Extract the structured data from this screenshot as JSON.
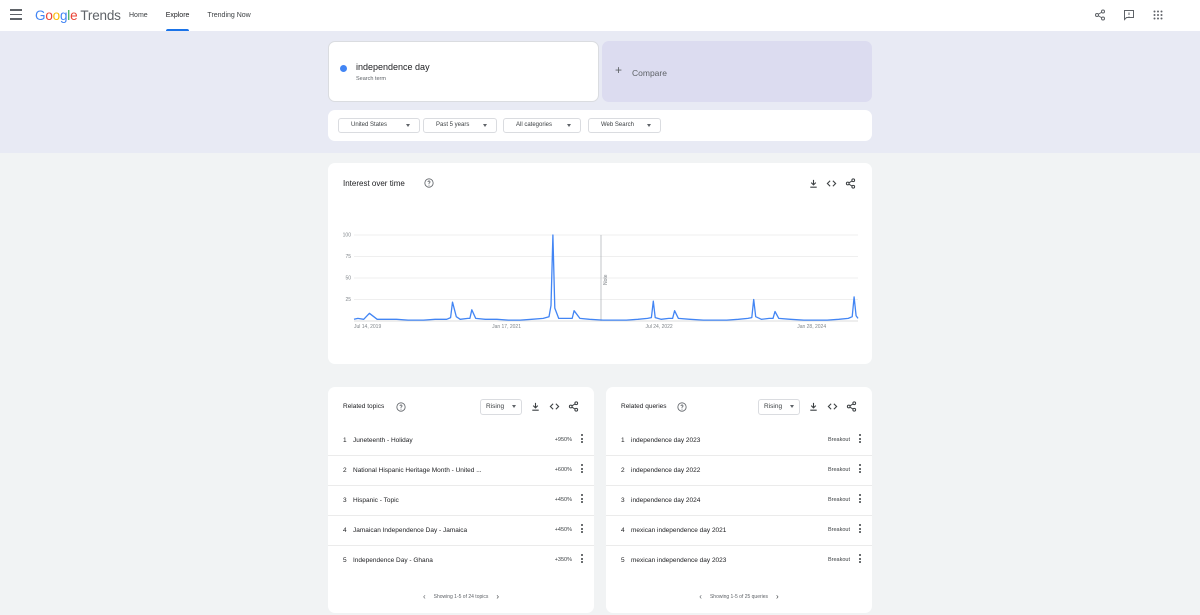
{
  "header": {
    "logo": "Google",
    "logo_suffix": "Trends",
    "nav": [
      "Home",
      "Explore",
      "Trending Now"
    ],
    "active_nav": "Explore"
  },
  "search": {
    "term": "independence day",
    "term_type": "Search term",
    "compare_label": "Compare",
    "term_color": "#4285f4"
  },
  "filters": {
    "region": "United States",
    "period": "Past 5 years",
    "category": "All categories",
    "property": "Web Search"
  },
  "interest": {
    "title": "Interest over time",
    "note_label": "Note"
  },
  "chart_data": {
    "type": "line",
    "title": "Interest over time",
    "ylim": [
      0,
      100
    ],
    "y_ticks": [
      "100",
      "75",
      "50",
      "25"
    ],
    "x_tick_labels": [
      "Jul 14, 2019",
      "Jan 17, 2021",
      "Jul 24, 2022",
      "Jan 28, 2024"
    ],
    "grid": true,
    "series": [
      {
        "color": "#4285f4",
        "x": [
          "2019-07-14",
          "2019-07-28",
          "2019-08-18",
          "2019-09-08",
          "2019-10-06",
          "2019-11-03",
          "2019-12-15",
          "2020-01-26",
          "2020-02-23",
          "2020-03-22",
          "2020-05-03",
          "2020-06-14",
          "2020-06-28",
          "2020-07-05",
          "2020-07-19",
          "2020-08-02",
          "2020-08-30",
          "2020-09-06",
          "2020-09-13",
          "2020-09-27",
          "2020-11-01",
          "2020-12-13",
          "2021-01-24",
          "2021-03-07",
          "2021-04-18",
          "2021-05-30",
          "2021-06-20",
          "2021-06-27",
          "2021-07-04",
          "2021-07-11",
          "2021-07-25",
          "2021-08-29",
          "2021-09-12",
          "2021-09-19",
          "2021-10-10",
          "2021-11-14",
          "2022-01-02",
          "2022-02-13",
          "2022-03-27",
          "2022-05-08",
          "2022-06-12",
          "2022-06-26",
          "2022-07-03",
          "2022-07-10",
          "2022-07-31",
          "2022-08-28",
          "2022-09-11",
          "2022-09-18",
          "2022-10-02",
          "2022-11-13",
          "2023-01-01",
          "2023-02-12",
          "2023-03-26",
          "2023-05-07",
          "2023-06-11",
          "2023-06-25",
          "2023-07-02",
          "2023-07-09",
          "2023-07-30",
          "2023-08-27",
          "2023-09-10",
          "2023-09-17",
          "2023-10-01",
          "2023-11-12",
          "2023-12-31",
          "2024-02-11",
          "2024-03-24",
          "2024-05-05",
          "2024-06-09",
          "2024-06-23",
          "2024-06-30",
          "2024-07-07",
          "2024-07-14"
        ],
        "values": [
          2,
          3,
          2,
          9,
          2,
          2,
          2,
          1,
          1,
          1,
          2,
          2,
          4,
          22,
          5,
          2,
          3,
          3,
          13,
          3,
          2,
          2,
          1,
          1,
          2,
          3,
          5,
          18,
          100,
          15,
          3,
          3,
          3,
          12,
          3,
          2,
          1,
          1,
          1,
          2,
          3,
          4,
          23,
          4,
          2,
          3,
          3,
          12,
          3,
          2,
          1,
          1,
          1,
          2,
          3,
          4,
          25,
          5,
          2,
          3,
          3,
          11,
          3,
          2,
          1,
          1,
          1,
          2,
          3,
          5,
          28,
          6,
          3
        ]
      }
    ]
  },
  "related_topics": {
    "title": "Related topics",
    "mode": "Rising",
    "rows": [
      {
        "n": "1",
        "label": "Juneteenth - Holiday",
        "value": "+950%"
      },
      {
        "n": "2",
        "label": "National Hispanic Heritage Month - United ...",
        "value": "+600%"
      },
      {
        "n": "3",
        "label": "Hispanic - Topic",
        "value": "+450%"
      },
      {
        "n": "4",
        "label": "Jamaican Independence Day - Jamaica",
        "value": "+450%"
      },
      {
        "n": "5",
        "label": "Independence Day - Ghana",
        "value": "+350%"
      }
    ],
    "pager": "Showing 1-5 of 24 topics"
  },
  "related_queries": {
    "title": "Related queries",
    "mode": "Rising",
    "rows": [
      {
        "n": "1",
        "label": "independence day 2023",
        "value": "Breakout"
      },
      {
        "n": "2",
        "label": "independence day 2022",
        "value": "Breakout"
      },
      {
        "n": "3",
        "label": "independence day 2024",
        "value": "Breakout"
      },
      {
        "n": "4",
        "label": "mexican independence day 2021",
        "value": "Breakout"
      },
      {
        "n": "5",
        "label": "mexican independence day 2023",
        "value": "Breakout"
      }
    ],
    "pager": "Showing 1-5 of 25 queries"
  }
}
